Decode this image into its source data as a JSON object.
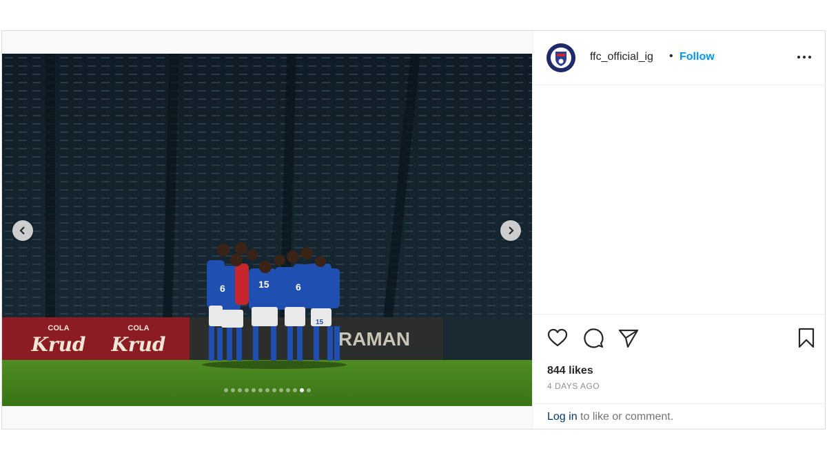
{
  "post": {
    "username": "ffc_official_ig",
    "separator": "•",
    "follow_label": "Follow",
    "likes": "844 likes",
    "date": "4 DAYS AGO",
    "login_link": "Log in",
    "login_rest": " to like or comment."
  },
  "media": {
    "board_text_1": "COLA",
    "board_brand_1": "Krud",
    "board_text_2": "COLA",
    "board_brand_2": "Krud",
    "board_text_3": "RAMAN",
    "carousel_count": 13,
    "carousel_active_index": 11
  },
  "icons": {
    "prev": "chevron-left-icon",
    "next": "chevron-right-icon",
    "more": "more-horizontal-icon",
    "like": "heart-icon",
    "comment": "comment-icon",
    "share": "paper-plane-icon",
    "save": "bookmark-icon"
  },
  "colors": {
    "follow": "#0095f6",
    "login": "#00376b",
    "muted": "#8e8e8e",
    "board_red": "#8b1c24"
  }
}
